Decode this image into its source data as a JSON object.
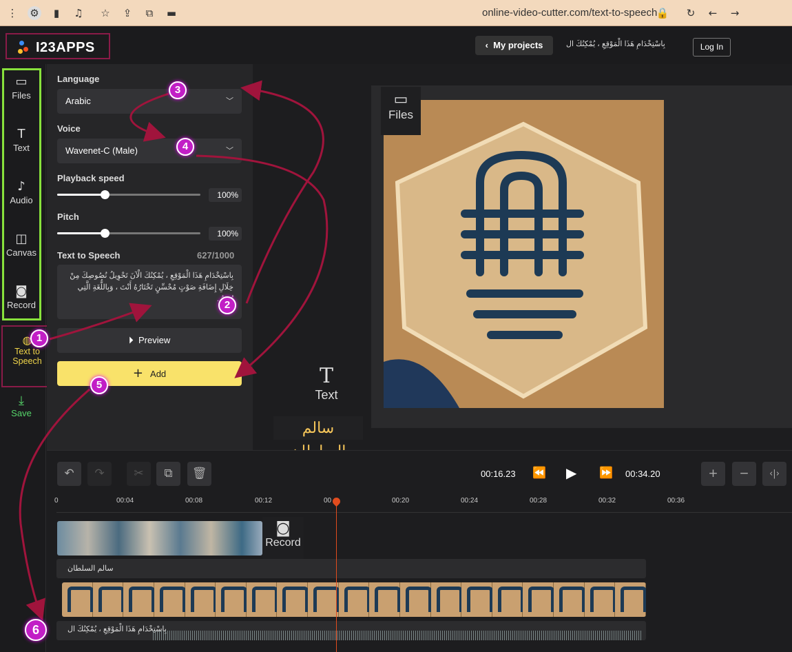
{
  "browser": {
    "url": "online-video-cutter.com/text-to-speech"
  },
  "header": {
    "logo": "I23APPS",
    "my_projects": "My projects",
    "project_title": "بِاسْتِخْدَامِ هَذَا الْمَوْقِعِ ، يُمْكِنُكَ ال",
    "login": "Log In"
  },
  "sidebar": {
    "items": [
      {
        "label": "Files",
        "icon": "archive-icon"
      },
      {
        "label": "Text",
        "icon": "text-icon"
      },
      {
        "label": "Audio",
        "icon": "music-icon"
      },
      {
        "label": "Canvas",
        "icon": "canvas-icon"
      },
      {
        "label": "Record",
        "icon": "camera-icon"
      }
    ],
    "tts_label": "Text to Speech",
    "save_label": "Save"
  },
  "panel": {
    "language_label": "Language",
    "language_value": "Arabic",
    "voice_label": "Voice",
    "voice_value": "Wavenet-C (Male)",
    "speed_label": "Playback speed",
    "speed_value": "100%",
    "speed_level": 0.33,
    "pitch_label": "Pitch",
    "pitch_value": "100%",
    "pitch_level": 0.33,
    "tts_label": "Text to Speech",
    "char_count": "627/1000",
    "tts_text": "بِاسْتِخْدَامِ هَذَا الْمَوْقِعِ ، يُمْكِنُكَ الْآنَ تَحْوِيلُ نُصُوصِكَ مِنْ خِلَالِ إِضَافَةِ صَوْتٍ مُحْسِّنٍ تَخْتَارُهُ أَنْتَ ، وَبِاللُّغَةِ الَّتِي تُرِيدُ .",
    "preview_label": "Preview",
    "add_label": "Add"
  },
  "preview": {
    "files_overlay": "Files",
    "text_overlay": "Text",
    "overlay_text": "سالم السلطان"
  },
  "timeline": {
    "current_time": "00:16.23",
    "total_time": "00:34.20",
    "ticks": [
      "0",
      "00:04",
      "00:08",
      "00:12",
      "00",
      "00:20",
      "00:24",
      "00:28",
      "00:32",
      "00:36"
    ],
    "record_overlay": "Record",
    "text_track": "سالم السلطان",
    "audio_track": "بِاسْتِخْدَامِ هَذَا الْمَوْقِعِ ، يُمْكِنُكَ ال"
  },
  "annotations": [
    "1",
    "2",
    "3",
    "4",
    "5",
    "6"
  ],
  "colors": {
    "accent": "#f9e26a",
    "annotation": "#c21ec6",
    "arrow": "#a0143c",
    "green_box": "#88e23c",
    "save": "#56d56a",
    "playhead": "#e24c1e"
  }
}
